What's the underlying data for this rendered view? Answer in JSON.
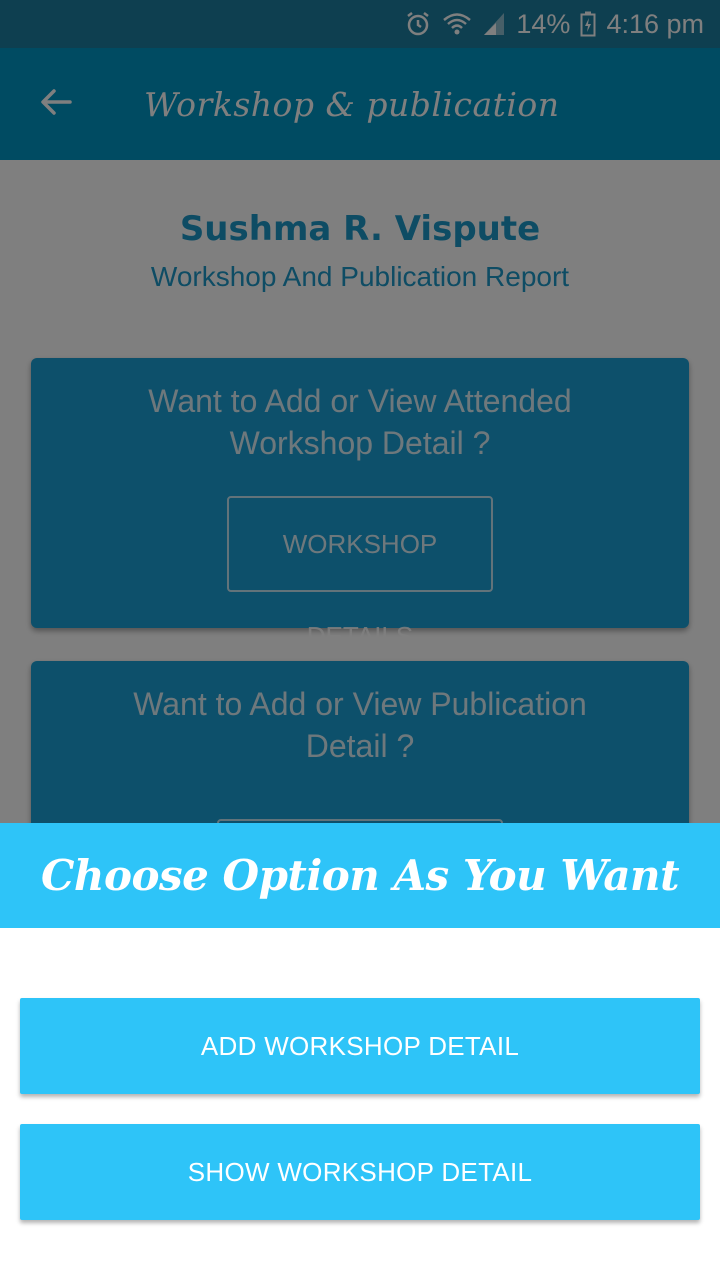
{
  "status_bar": {
    "battery_percent": "14%",
    "time": "4:16 pm",
    "icons": [
      "alarm-icon",
      "wifi-icon",
      "signal-icon",
      "battery-icon"
    ]
  },
  "app_bar": {
    "title": "Workshop & publication",
    "back_icon": "arrow-left-icon"
  },
  "header": {
    "name": "Sushma R. Vispute",
    "subtitle": "Workshop And Publication Report"
  },
  "cards": [
    {
      "question": "Want to Add or View Attended Workshop Detail ?",
      "button_label": "WORKSHOP DETAILS"
    },
    {
      "question": "Want to Add or View Publication Detail ?",
      "button_label": ""
    }
  ],
  "sheet": {
    "title": "Choose Option As You Want",
    "options": [
      "ADD WORKSHOP DETAIL",
      "SHOW WORKSHOP DETAIL"
    ]
  },
  "colors": {
    "primary": "#0096c4",
    "accent": "#2ec4f8",
    "card": "#1ba0d6"
  }
}
